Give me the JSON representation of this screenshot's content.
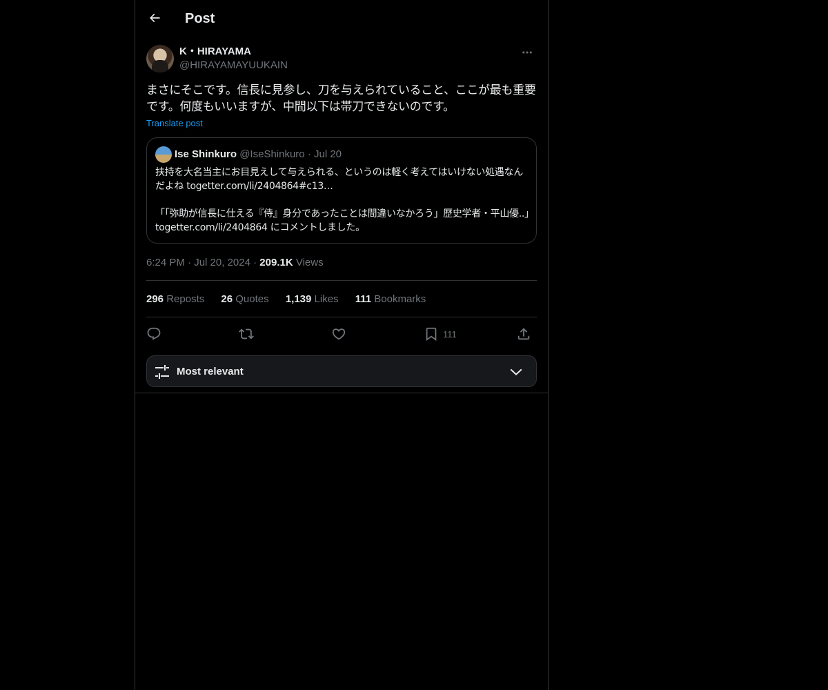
{
  "header": {
    "title": "Post"
  },
  "author": {
    "name": "K・HIRAYAMA",
    "handle": "@HIRAYAMAYUUKAIN"
  },
  "post": {
    "text": "まさにそこです。信長に見参し、刀を与えられていること、ここが最も重要です。何度もいいますが、中間以下は帯刀できないのです。",
    "translate_label": "Translate post"
  },
  "quote": {
    "name": "Ise Shinkuro",
    "handle": "@IseShinkuro",
    "separator": "·",
    "date": "Jul 20",
    "paragraph1": "扶持を大名当主にお目見えして与えられる、というのは軽く考えてはいけない処遇なんだよね togetter.com/li/2404864#c13…",
    "paragraph2": "「「弥助が信長に仕える『侍』身分であったことは間違いなかろう」歴史学者・平山優..」togetter.com/li/2404864 にコメントしました。"
  },
  "meta": {
    "time": "6:24 PM",
    "separator": "·",
    "date": "Jul 20, 2024",
    "views_count": "209.1K",
    "views_label": "Views"
  },
  "stats": [
    {
      "count": "296",
      "label": "Reposts"
    },
    {
      "count": "26",
      "label": "Quotes"
    },
    {
      "count": "1,139",
      "label": "Likes"
    },
    {
      "count": "111",
      "label": "Bookmarks"
    }
  ],
  "actions": {
    "reply_icon": "reply-icon",
    "repost_icon": "repost-icon",
    "like_icon": "heart-icon",
    "bookmark_icon": "bookmark-icon",
    "bookmark_count": "111",
    "share_icon": "share-icon"
  },
  "sort": {
    "label": "Most relevant"
  },
  "colors": {
    "background": "#000000",
    "text": "#e7e9ea",
    "muted": "#71767b",
    "accent": "#1d9bf0",
    "border": "#2f3336"
  }
}
